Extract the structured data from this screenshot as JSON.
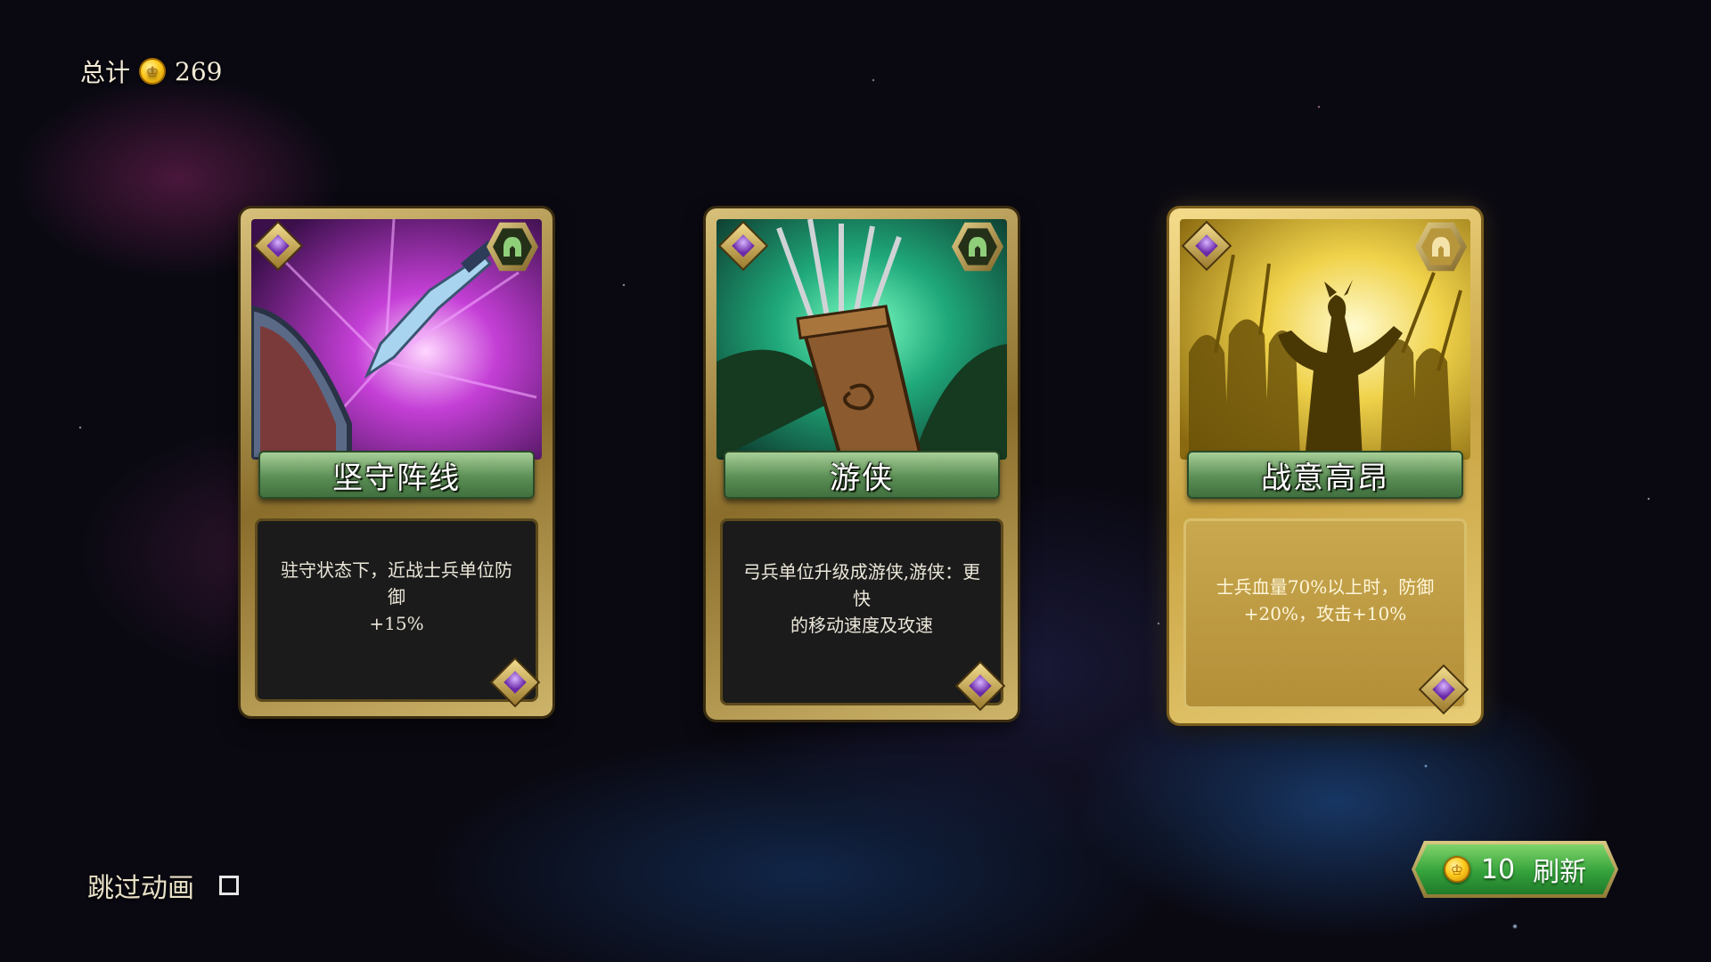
{
  "header": {
    "total_label": "总计",
    "coin_icon": "gold-coin-icon",
    "total_value": "269"
  },
  "cards": [
    {
      "title": "坚守阵线",
      "description_line1": "驻守状态下，近战士兵单位防御",
      "description_line2": "+15%",
      "badge_icon": "helmet-icon",
      "art_icon": "spear-shield-art",
      "style": "dark"
    },
    {
      "title": "游侠",
      "description_line1": "弓兵单位升级成游侠,游侠：更快",
      "description_line2": "的移动速度及攻速",
      "badge_icon": "helmet-icon",
      "art_icon": "arrow-quiver-art",
      "style": "dark"
    },
    {
      "title": "战意高昂",
      "description_line1": "士兵血量70%以上时，防御",
      "description_line2": "+20%，攻击+10%",
      "badge_icon": "helmet-icon",
      "art_icon": "army-silhouette-art",
      "style": "gold"
    }
  ],
  "footer": {
    "skip_label": "跳过动画",
    "skip_checked": false,
    "refresh_cost": "10",
    "refresh_label": "刷新"
  },
  "colors": {
    "banner_green": "#5b8f55",
    "frame_gold": "#c9a443",
    "button_green": "#35a23b"
  }
}
